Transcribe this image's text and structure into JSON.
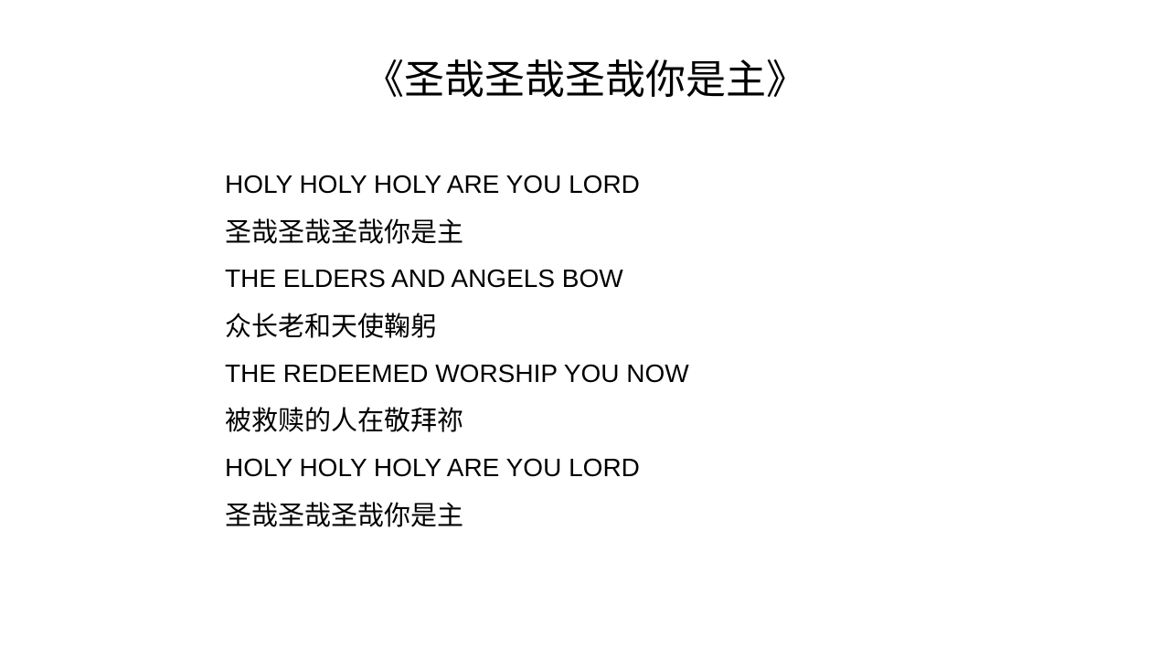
{
  "slide": {
    "title": "《圣哉圣哉圣哉你是主》",
    "lines": [
      {
        "text": "HOLY HOLY HOLY ARE YOU LORD",
        "lang": "en"
      },
      {
        "text": "圣哉圣哉圣哉你是主",
        "lang": "zh"
      },
      {
        "text": "THE ELDERS AND ANGELS BOW",
        "lang": "en"
      },
      {
        "text": "众长老和天使鞠躬",
        "lang": "zh"
      },
      {
        "text": "THE REDEEMED WORSHIP YOU NOW",
        "lang": "en"
      },
      {
        "text": "被救赎的人在敬拜祢",
        "lang": "zh"
      },
      {
        "text": "HOLY HOLY HOLY ARE YOU LORD",
        "lang": "en"
      },
      {
        "text": "圣哉圣哉圣哉你是主",
        "lang": "zh"
      }
    ]
  },
  "colors": {
    "background": "#ffffff",
    "text": "#000000"
  }
}
